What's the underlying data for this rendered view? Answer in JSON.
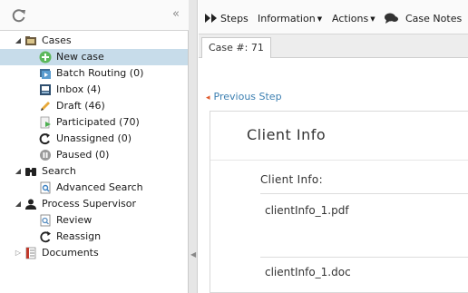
{
  "sidebar": {
    "refresh_icon": "refresh-icon",
    "collapse_glyph": "«",
    "tree": [
      {
        "label": "Cases",
        "icon": "cases-folder-icon",
        "expanded": true
      },
      {
        "label": "New case",
        "icon": "new-case-icon"
      },
      {
        "label": "Batch Routing (0)",
        "icon": "batch-routing-icon"
      },
      {
        "label": "Inbox (4)",
        "icon": "inbox-icon"
      },
      {
        "label": "Draft (46)",
        "icon": "draft-pencil-icon"
      },
      {
        "label": "Participated (70)",
        "icon": "participated-icon"
      },
      {
        "label": "Unassigned (0)",
        "icon": "unassigned-icon"
      },
      {
        "label": "Paused (0)",
        "icon": "paused-icon"
      },
      {
        "label": "Search",
        "icon": "binoculars-icon",
        "expanded": true
      },
      {
        "label": "Advanced Search",
        "icon": "advanced-search-icon"
      },
      {
        "label": "Process Supervisor",
        "icon": "supervisor-user-icon",
        "expanded": true
      },
      {
        "label": "Review",
        "icon": "review-icon"
      },
      {
        "label": "Reassign",
        "icon": "reassign-icon"
      },
      {
        "label": "Documents",
        "icon": "documents-icon",
        "expanded": false
      }
    ]
  },
  "toolbar": {
    "steps": "Steps",
    "information": "Information",
    "actions": "Actions",
    "case_notes": "Case Notes"
  },
  "tab": {
    "label": "Case #: 71"
  },
  "content": {
    "previous_step": "Previous Step",
    "title": "Client Info",
    "subtitle": "Client Info:",
    "files": [
      "clientInfo_1.pdf",
      "clientInfo_1.doc"
    ]
  },
  "colors": {
    "selected_row": "#c7dcea",
    "link": "#3c7fb1",
    "new_case_green": "#5cb85c"
  }
}
